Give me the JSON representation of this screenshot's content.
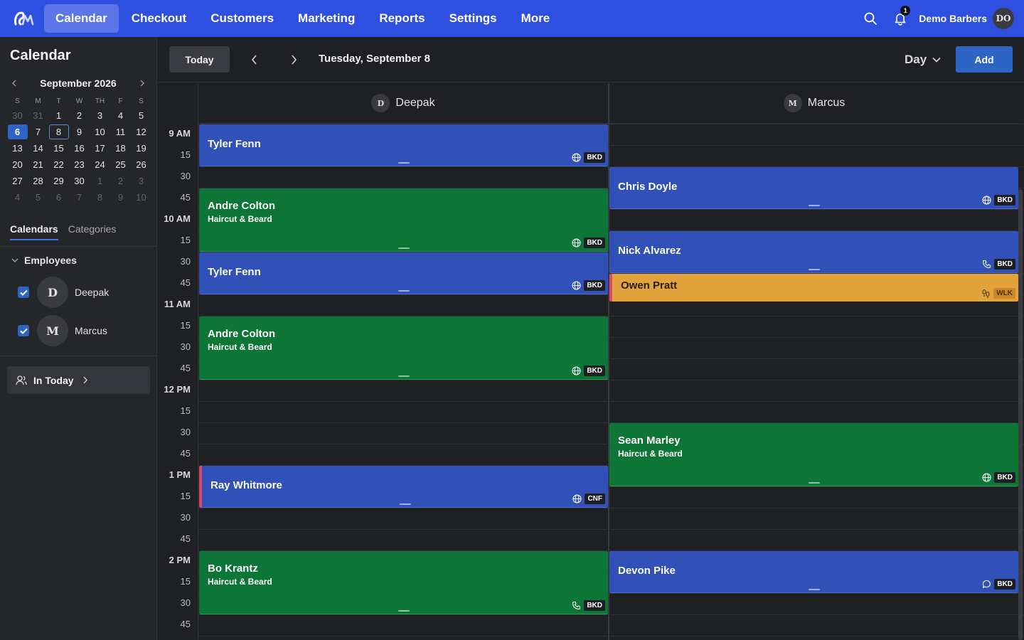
{
  "nav": {
    "items": [
      "Calendar",
      "Checkout",
      "Customers",
      "Marketing",
      "Reports",
      "Settings",
      "More"
    ],
    "active_index": 0,
    "notification_count": "1",
    "account_name": "Demo Barbers",
    "account_initials": "DO"
  },
  "sidebar": {
    "title": "Calendar",
    "mini_calendar": {
      "month_label": "September 2026",
      "weekdays": [
        "S",
        "M",
        "T",
        "W",
        "TH",
        "F",
        "S"
      ],
      "weeks": [
        [
          "30",
          "31",
          "1",
          "2",
          "3",
          "4",
          "5"
        ],
        [
          "6",
          "7",
          "8",
          "9",
          "10",
          "11",
          "12"
        ],
        [
          "13",
          "14",
          "15",
          "16",
          "17",
          "18",
          "19"
        ],
        [
          "20",
          "21",
          "22",
          "23",
          "24",
          "25",
          "26"
        ],
        [
          "27",
          "28",
          "29",
          "30",
          "1",
          "2",
          "3"
        ],
        [
          "4",
          "5",
          "6",
          "7",
          "8",
          "9",
          "10"
        ]
      ],
      "today": "6",
      "selected": "8"
    },
    "tabs": [
      "Calendars",
      "Categories"
    ],
    "group_label": "Employees",
    "employees": [
      {
        "name": "Deepak",
        "initial": "D",
        "checked": true
      },
      {
        "name": "Marcus",
        "initial": "M",
        "checked": true
      }
    ],
    "in_today_label": "In Today"
  },
  "toolbar": {
    "today_label": "Today",
    "date_label": "Tuesday, September 8",
    "view_label": "Day",
    "add_label": "Add"
  },
  "calendar": {
    "columns": [
      {
        "name": "Deepak",
        "initial": "D"
      },
      {
        "name": "Marcus",
        "initial": "M"
      }
    ],
    "time_labels": [
      "9 AM",
      "15",
      "30",
      "45",
      "10 AM",
      "15",
      "30",
      "45",
      "11 AM",
      "15",
      "30",
      "45",
      "12 PM",
      "15",
      "30",
      "45",
      "1 PM",
      "15",
      "30",
      "45",
      "2 PM",
      "15",
      "30",
      "45"
    ],
    "appointments": [
      {
        "col": 0,
        "name": "Tyler Fenn",
        "service": "",
        "color": "blue",
        "icon": "globe",
        "tag": "BKD",
        "start": "9:00",
        "end": "9:30"
      },
      {
        "col": 0,
        "name": "Andre Colton",
        "service": "Haircut & Beard",
        "color": "green",
        "icon": "globe",
        "tag": "BKD",
        "start": "9:45",
        "end": "10:30"
      },
      {
        "col": 0,
        "name": "Tyler Fenn",
        "service": "",
        "color": "blue",
        "icon": "globe",
        "tag": "BKD",
        "start": "10:30",
        "end": "11:00"
      },
      {
        "col": 0,
        "name": "Andre Colton",
        "service": "Haircut & Beard",
        "color": "green",
        "icon": "globe",
        "tag": "BKD",
        "start": "11:15",
        "end": "12:00"
      },
      {
        "col": 0,
        "name": "Ray Whitmore",
        "service": "",
        "color": "blue",
        "icon": "globe",
        "tag": "CNF",
        "start": "13:00",
        "end": "13:30",
        "flag": true
      },
      {
        "col": 0,
        "name": "Bo Krantz",
        "service": "Haircut & Beard",
        "color": "green",
        "icon": "phone",
        "tag": "BKD",
        "start": "14:00",
        "end": "14:45"
      },
      {
        "col": 1,
        "name": "Chris Doyle",
        "service": "",
        "color": "blue",
        "icon": "globe",
        "tag": "BKD",
        "start": "9:30",
        "end": "10:00"
      },
      {
        "col": 1,
        "name": "Nick Alvarez",
        "service": "",
        "color": "blue",
        "icon": "phone",
        "tag": "BKD",
        "start": "10:15",
        "end": "10:45"
      },
      {
        "col": 1,
        "name": "Owen Pratt",
        "service": "",
        "color": "orange",
        "icon": "walk",
        "tag": "WLK",
        "start": "10:45",
        "end": "11:05"
      },
      {
        "col": 1,
        "name": "Sean Marley",
        "service": "Haircut & Beard",
        "color": "green",
        "icon": "globe",
        "tag": "BKD",
        "start": "12:30",
        "end": "13:15"
      },
      {
        "col": 1,
        "name": "Devon Pike",
        "service": "",
        "color": "blue",
        "icon": "chat",
        "tag": "BKD",
        "start": "14:00",
        "end": "14:30"
      }
    ]
  },
  "colors": {
    "nav_bg": "#2f4fe0",
    "accent": "#2e65c5",
    "appt_blue": "#3150b8",
    "appt_green": "#0d7636",
    "appt_orange": "#e2a33c",
    "flag_pink": "#e0476a"
  }
}
